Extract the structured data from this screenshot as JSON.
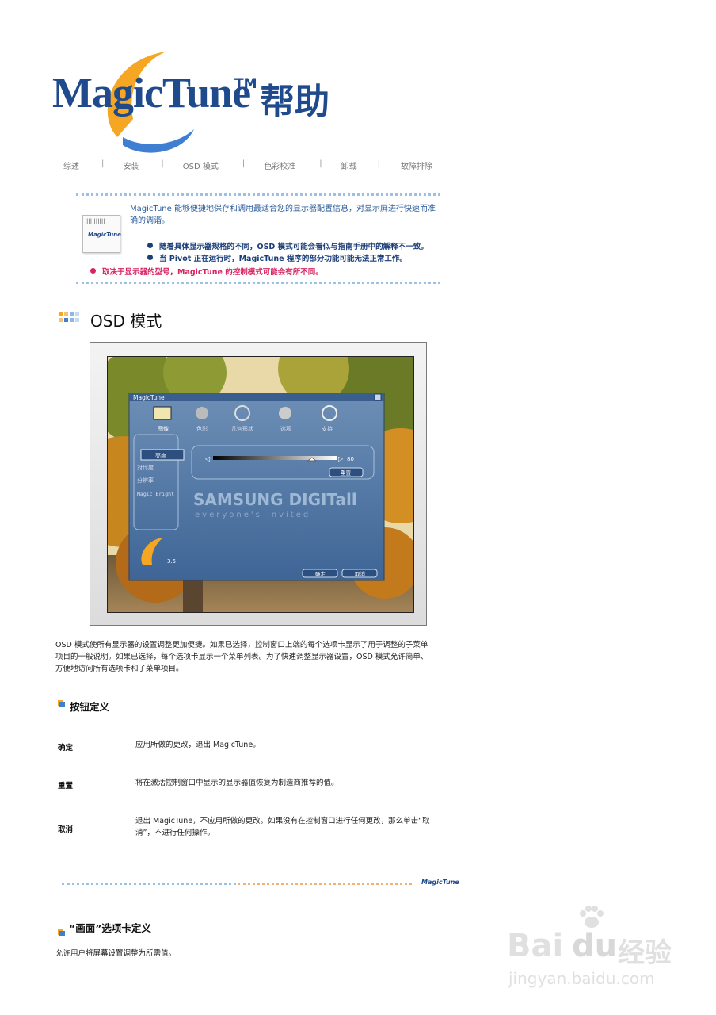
{
  "logo": {
    "word": "MagicTune",
    "tm": "TM",
    "help": "帮助"
  },
  "nav": [
    "综述",
    "安装",
    "OSD 模式",
    "色彩校准",
    "卸载",
    "故障排除"
  ],
  "nav_sep": "|",
  "note": {
    "icon_text": "MagicTune",
    "intro_line1": "MagicTune 能够便捷地保存和调用最适合您的显示器配置信息，对显示屏进行快速而准",
    "intro_line2": "确的调谐。",
    "bullet1": "随着具体显示器规格的不同，OSD 模式可能会看似与指南手册中的解释不一致。",
    "bullet2": "当 Pivot 正在运行时，MagicTune 程序的部分功能可能无法正常工作。",
    "bullet_red": "取决于显示器的型号，MagicTune 的控制模式可能会有所不同。"
  },
  "section_title": "OSD 模式",
  "screenshot": {
    "window_title": "MagicTune",
    "tabs": [
      "图像",
      "色彩",
      "几何形状",
      "选项",
      "支持"
    ],
    "menu": [
      "亮度",
      "对比度",
      "分辨率",
      "Magic Bright"
    ],
    "slider_value": "80",
    "slider_fraction": 0.8,
    "reset_btn": "重置",
    "brand1": "SAMSUNG DIGITall",
    "brand2": "everyone's invited",
    "version": "3.5",
    "ok_btn": "确定",
    "cancel_btn": "取消"
  },
  "paragraph": {
    "line1": "OSD 模式使所有显示器的设置调整更加便捷。如果已选择，控制窗口上端的每个选项卡显示了用于调整的子菜单",
    "line2": "项目的一般说明。如果已选择，每个选项卡显示一个菜单列表。为了快速调整显示器设置，OSD 模式允许简单、",
    "line3": "方便地访问所有选项卡和子菜单项目。"
  },
  "buttons_heading": "按钮定义",
  "buttons_table": [
    {
      "key": "确定",
      "val1": "应用所做的更改，退出 MagicTune。",
      "val2": ""
    },
    {
      "key": "重置",
      "val1": "将在激活控制窗口中显示的显示器值恢复为制造商推荐的值。",
      "val2": ""
    },
    {
      "key": "取消",
      "val1": "退出 MagicTune，不应用所做的更改。如果没有在控制窗口进行任何更改，那么单击“取",
      "val2": "消”，不进行任何操作。"
    }
  ],
  "footer_logo": "MagicTune",
  "tab_heading": "“画面”选项卡定义",
  "tab_paragraph": "允许用户将屏幕设置调整为所需值。",
  "watermark": {
    "main": "Bai",
    "du": "du",
    "cn": "经验",
    "url": "jingyan.baidu.com"
  },
  "colors": {
    "brand_blue": "#1f4a8c",
    "accent_orange": "#f5a623",
    "alert_red": "#d8235f"
  }
}
